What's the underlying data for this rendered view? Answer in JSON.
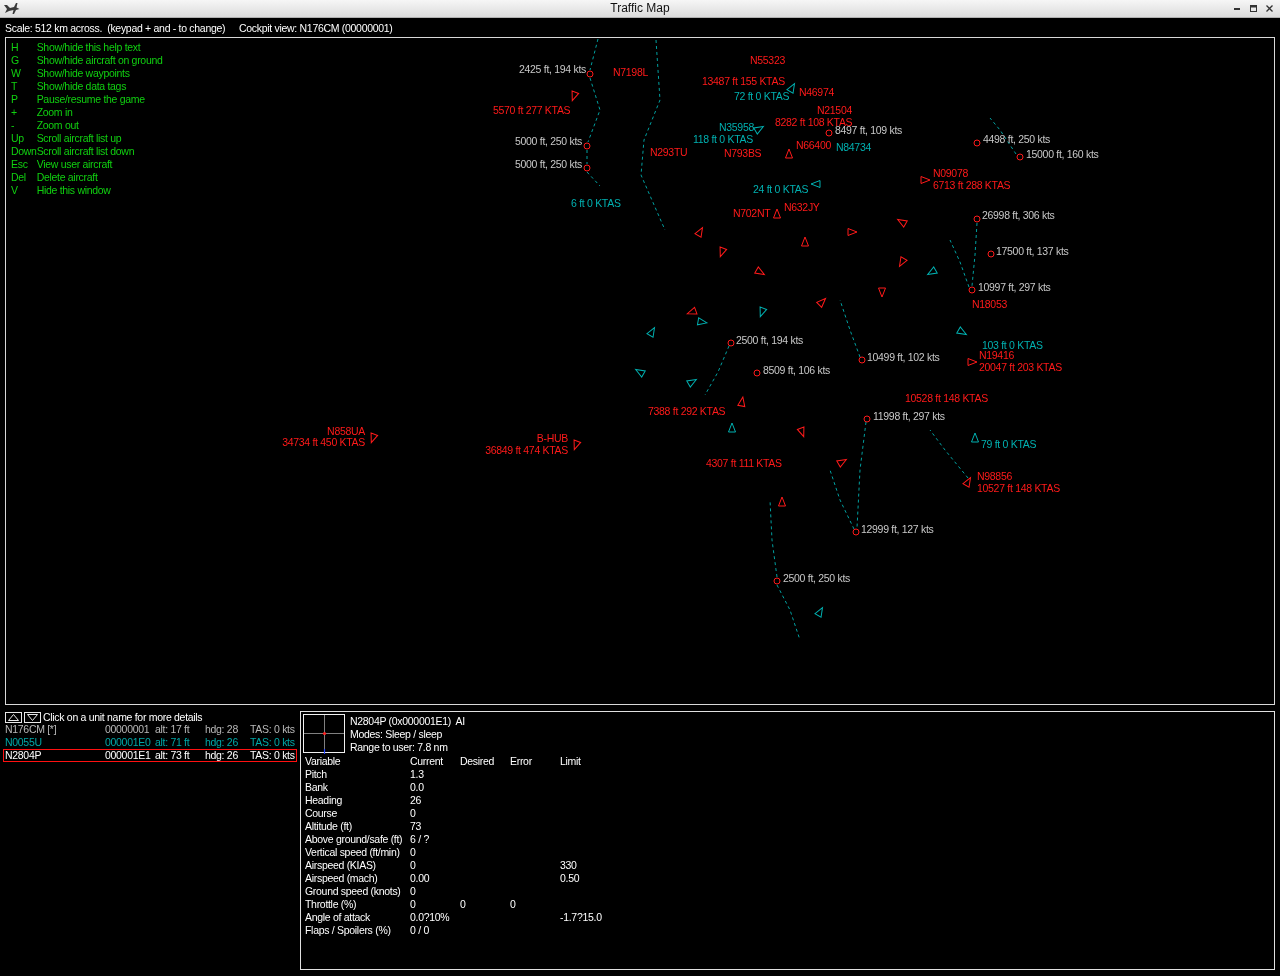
{
  "window": {
    "title": "Traffic Map"
  },
  "info_bar": {
    "scale": "Scale: 512 km across.  (keypad + and - to change)",
    "cockpit_view": "Cockpit view: N176CM (00000001)"
  },
  "help": [
    {
      "key": "H",
      "action": "Show/hide this help text"
    },
    {
      "key": "G",
      "action": "Show/hide aircraft on ground"
    },
    {
      "key": "W",
      "action": "Show/hide waypoints"
    },
    {
      "key": "T",
      "action": "Show/hide data tags"
    },
    {
      "key": "P",
      "action": "Pause/resume the game"
    },
    {
      "key": "+",
      "action": "Zoom in"
    },
    {
      "key": "-",
      "action": "Zoom out"
    },
    {
      "key": "Up",
      "action": "Scroll aircraft list up"
    },
    {
      "key": "Down",
      "action": "Scroll aircraft list down"
    },
    {
      "key": "Esc",
      "action": "View user aircraft"
    },
    {
      "key": "Del",
      "action": "Delete aircraft"
    },
    {
      "key": "V",
      "action": "Hide this window"
    }
  ],
  "map": {
    "aircraft": [
      {
        "kind": "airborne",
        "callsign": "N55323"
      },
      {
        "kind": "airborne",
        "callsign": "N7198L"
      },
      {
        "kind": "airborne",
        "data": "13487 ft 155 KTAS"
      },
      {
        "kind": "ground",
        "data": "72 ft 0 KTAS"
      },
      {
        "kind": "airborne",
        "callsign": "N46974"
      },
      {
        "kind": "airborne",
        "data": "5570 ft 277 KTAS"
      },
      {
        "kind": "airborne",
        "callsign": "N21504"
      },
      {
        "kind": "airborne",
        "data": "8282 ft 108 KTAS"
      },
      {
        "kind": "ground",
        "callsign": "N35958",
        "data": "118 ft 0 KTAS"
      },
      {
        "kind": "airborne",
        "callsign": "N66400"
      },
      {
        "kind": "ground",
        "callsign": "N84734"
      },
      {
        "kind": "airborne",
        "callsign": "N293TU"
      },
      {
        "kind": "airborne",
        "callsign": "N793BS"
      },
      {
        "kind": "airborne",
        "callsign": "N09078",
        "data": "6713 ft 288 KTAS"
      },
      {
        "kind": "ground",
        "data": "24 ft 0 KTAS"
      },
      {
        "kind": "ground",
        "data": "6 ft 0 KTAS"
      },
      {
        "kind": "airborne",
        "callsign": "N702NT"
      },
      {
        "kind": "airborne",
        "callsign": "N632JY"
      },
      {
        "kind": "airborne",
        "callsign": "N18053"
      },
      {
        "kind": "ground",
        "data": "103 ft 0 KTAS"
      },
      {
        "kind": "airborne",
        "callsign": "N19416",
        "data": "20047 ft 203 KTAS"
      },
      {
        "kind": "airborne",
        "data": "10528 ft 148 KTAS"
      },
      {
        "kind": "airborne",
        "data": "7388 ft 292 KTAS"
      },
      {
        "kind": "airborne",
        "callsign": "N858UA",
        "data": "34734 ft 450 KTAS"
      },
      {
        "kind": "airborne",
        "callsign": "B-HUB",
        "data": "36849 ft 474 KTAS"
      },
      {
        "kind": "ground",
        "data": "79 ft 0 KTAS"
      },
      {
        "kind": "airborne",
        "data": "4307 ft 111 KTAS"
      },
      {
        "kind": "airborne",
        "callsign": "N98856",
        "data": "10527 ft 148 KTAS"
      }
    ],
    "waypoints": [
      {
        "label": "2425 ft, 194 kts"
      },
      {
        "label": "8497 ft, 109 kts"
      },
      {
        "label": "5000 ft, 250 kts"
      },
      {
        "label": "4498 ft, 250 kts"
      },
      {
        "label": "15000 ft, 160 kts"
      },
      {
        "label": "5000 ft, 250 kts"
      },
      {
        "label": "26998 ft, 306 kts"
      },
      {
        "label": "17500 ft, 137 kts"
      },
      {
        "label": "10997 ft, 297 kts"
      },
      {
        "label": "2500 ft, 194 kts"
      },
      {
        "label": "10499 ft, 102 kts"
      },
      {
        "label": "8509 ft, 106 kts"
      },
      {
        "label": "11998 ft, 297 kts"
      },
      {
        "label": "12999 ft, 127 kts"
      },
      {
        "label": "2500 ft, 250 kts"
      }
    ]
  },
  "unit_list": {
    "hint": "Click on a unit name for more details",
    "units": [
      {
        "kind": "user",
        "name": "N176CM [*]",
        "id": "00000001",
        "alt": "alt: 17 ft",
        "hdg": "hdg: 28",
        "tas": "TAS: 0 kts",
        "selected": false
      },
      {
        "kind": "ai",
        "name": "N0055U",
        "id": "000001E0",
        "alt": "alt: 71 ft",
        "hdg": "hdg: 26",
        "tas": "TAS: 0 kts",
        "selected": false
      },
      {
        "kind": "ai",
        "name": "N2804P",
        "id": "000001E1",
        "alt": "alt: 73 ft",
        "hdg": "hdg: 26",
        "tas": "TAS: 0 kts",
        "selected": true
      }
    ]
  },
  "details": {
    "title": "N2804P (0x000001E1)  AI",
    "modes": "Modes: Sleep / sleep",
    "range": "Range to user: 7.8 nm",
    "columns": [
      "Variable",
      "Current",
      "Desired",
      "Error",
      "Limit"
    ],
    "rows": [
      {
        "variable": "Pitch",
        "current": "1.3"
      },
      {
        "variable": "Bank",
        "current": "0.0"
      },
      {
        "variable": "Heading",
        "current": "26"
      },
      {
        "variable": "Course",
        "current": "0"
      },
      {
        "variable": "Altitude (ft)",
        "current": "73"
      },
      {
        "variable": "Above ground/safe (ft)",
        "current": "6 / ?"
      },
      {
        "variable": "Vertical speed (ft/min)",
        "current": "0"
      },
      {
        "variable": "Airspeed (KIAS)",
        "current": "0",
        "limit": "330"
      },
      {
        "variable": "Airspeed (mach)",
        "current": "0.00",
        "limit": "0.50"
      },
      {
        "variable": "Ground speed (knots)",
        "current": "0"
      },
      {
        "variable": "Throttle (%)",
        "current": "0",
        "desired": "0",
        "error": "0"
      },
      {
        "variable": "Angle of attack",
        "current": "0.0?10%",
        "limit": "-1.7?15.0"
      },
      {
        "variable": "Flaps / Spoilers (%)",
        "current": "0 / 0"
      }
    ]
  }
}
